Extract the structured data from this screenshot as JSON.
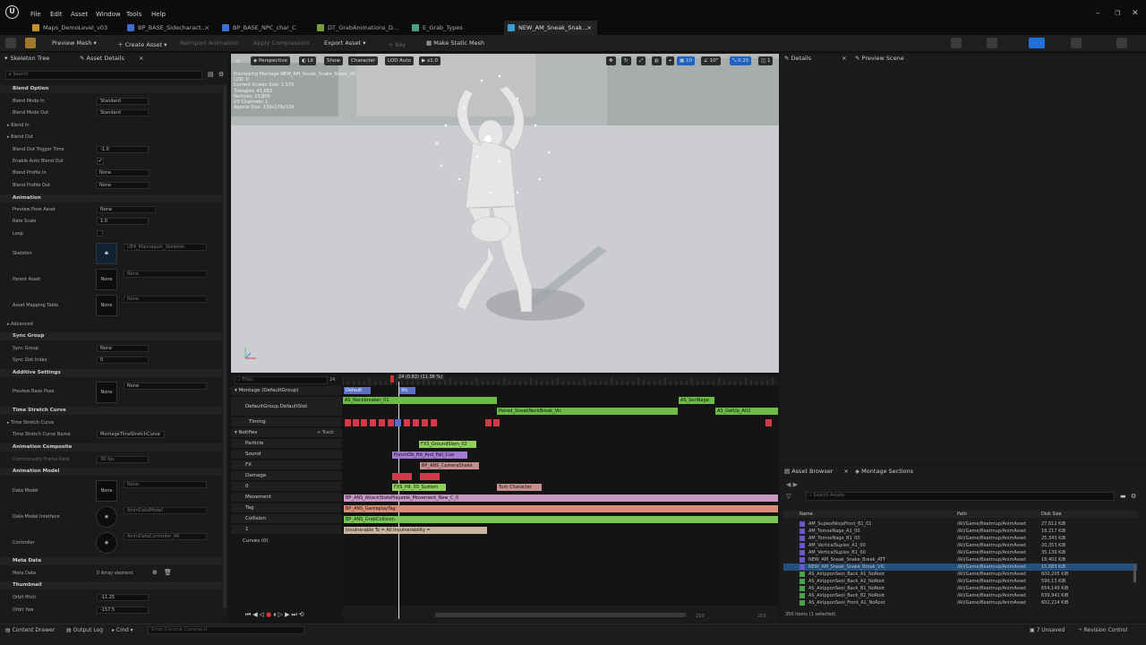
{
  "menu": [
    "File",
    "Edit",
    "Asset",
    "Window",
    "Tools",
    "Help"
  ],
  "tabs": [
    {
      "label": "Maps_DemoLevel_v03",
      "color": "#c7912d"
    },
    {
      "label": "BP_BASE_Sidecharact...",
      "color": "#3f6ed0"
    },
    {
      "label": "BP_BASE_NPC_char_C",
      "color": "#3f6ed0"
    },
    {
      "label": "DT_GrabAnimations_D...",
      "color": "#7a9b3c"
    },
    {
      "label": "E_Grab_Types",
      "color": "#4a9e8a"
    },
    {
      "label": "NEW_AM_Sneak_Snak...",
      "color": "#3aa0d4"
    }
  ],
  "toolbar": {
    "preview_mesh": "Preview Mesh",
    "create_asset": "Create Asset",
    "reimport": "Reimport Animation",
    "apply_compression": "Apply Compression",
    "export_asset": "Export Asset",
    "key": "Key",
    "make_static_mesh": "Make Static Mesh"
  },
  "left": {
    "tab1": "Skeleton Tree",
    "tab2": "Asset Details",
    "search_placeholder": "Search",
    "sections": {
      "blend_option": "Blend Option",
      "animation": "Animation",
      "sync_group": "Sync Group",
      "additive": "Additive Settings",
      "time_stretch": "Time Stretch Curve",
      "composite": "Animation Composite",
      "anim_model": "Animation Model",
      "meta_data": "Meta Data",
      "thumbnail": "Thumbnail"
    },
    "rows": {
      "blend_mode_in": "Blend Mode In",
      "blend_mode_in_val": "Standard",
      "blend_mode_out": "Blend Mode Out",
      "blend_mode_out_val": "Standard",
      "blend_in": "Blend In",
      "blend_out": "Blend Out",
      "blend_out_trigger": "Blend Out Trigger Time",
      "blend_out_trigger_val": "-1.0",
      "enable_auto_blend": "Enable Auto Blend Out",
      "blend_profile_in": "Blend Profile In",
      "blend_profile_in_val": "None",
      "blend_profile_out": "Blend Profile Out",
      "blend_profile_out_val": "None",
      "preview_pose": "Preview Pose Asset",
      "preview_pose_val": "None",
      "rate_scale": "Rate Scale",
      "rate_scale_val": "1.0",
      "loop": "Loop",
      "skeleton": "Skeleton",
      "skeleton_val": "UE4_Mannequin_Skeleton",
      "parent_asset": "Parent Asset",
      "parent_asset_val": "None",
      "asset_mapping": "Asset Mapping Table",
      "asset_mapping_val": "None",
      "advanced": "Advanced",
      "sync_group": "Sync Group",
      "sync_group_val": "None",
      "sync_slot": "Sync Slot Index",
      "sync_slot_val": "0",
      "preview_base_pose": "Preview Base Pose",
      "preview_base_pose_val": "None",
      "time_stretch_curve": "Time Stretch Curve",
      "time_stretch_name": "Time Stretch Curve Name",
      "time_stretch_name_val": "MontageTimeStretchCurve",
      "commonality": "Commonality Frame Rate",
      "commonality_val": "30 fps",
      "data_model": "Data Model",
      "data_model_val": "None",
      "data_model_iface": "Data Model Interface",
      "data_model_iface_val": "AnimDataModel",
      "controller": "Controller",
      "controller_val": "AnimDataController_A6",
      "meta": "Meta Data",
      "meta_val": "0 Array element",
      "orbit_pitch": "Orbit Pitch",
      "orbit_pitch_val": "-11.25",
      "orbit_yaw": "Orbit Yaw",
      "orbit_yaw_val": "-157.5",
      "none_thumb": "None"
    }
  },
  "viewport": {
    "perspective": "Perspective",
    "lit": "Lit",
    "show": "Show",
    "character": "Character",
    "lod": "LOD Auto",
    "speed": "x1.0",
    "info": "Previewing Montage NEW_AM_Sneak_Snake_Break_Vic\nLOD: 0\nCurrent Screen Size: 1.170\nTriangles: 41,092\nVertices: 23,809\nUV Channels: 1\nApprox Size: 139x178x139",
    "grid_snap": "10",
    "rot_snap": "10°",
    "scale_snap": "0.25",
    "cam_speed": "1"
  },
  "sequencer": {
    "filter_placeholder": "Filter",
    "frame": "24",
    "playhead": "24 (0.82) (11.36 %)",
    "tracks": {
      "montage": "Montage (DefaultGroup)",
      "slot": "DefaultGroup.DefaultSlot",
      "timing": "Timing",
      "notifies": "Notifies",
      "add_track": "+ Track",
      "particle": "Particle",
      "sound": "Sound",
      "fx": "FX",
      "damage": "Damage",
      "zero": "0",
      "movement": "Movement",
      "tag": "Tag",
      "collision": "Collision",
      "one": "1",
      "curves": "Curves (0)"
    },
    "sections": {
      "default": "Default",
      "vic": "Vic"
    },
    "segments": {
      "neck": "AS_Neckbreaker_01",
      "paired": "Paired_SneakNeckBreak_Vic",
      "ss": "AS_SeriNage",
      "getup": "AS_GetUp_A02"
    },
    "notifies": {
      "ground": "FXS_GroundSlam_02",
      "punch": "PunchOb_Hit_And_Fall_Cue",
      "cam": "BP_ANS_CameraShake",
      "hit": "FXS_Hit_03_System",
      "turn": "Turn Character",
      "movement": "BP_ANS_AttackStatePlayable_Movement_New_C_0",
      "tag": "BP_ANS_GameplayTag",
      "coll": "BP_ANS_GrabCollision",
      "invuln": "Invulnerable To = All Invulnerability ="
    },
    "time_end": "210",
    "time_end2": "210"
  },
  "right": {
    "details": "Details",
    "preview_scene": "Preview Scene"
  },
  "browser": {
    "tab1": "Asset Browser",
    "tab2": "Montage Sections",
    "search_placeholder": "Search Assets",
    "col_name": "Name",
    "col_path": "Path",
    "col_size": "Disk Size",
    "rows": [
      {
        "name": "AM_SuplexNinjaFront_B1_01",
        "path": "/All/Game/Beatmup/AnimAsset",
        "size": "27,612 KiB",
        "c": "#6b53c9"
      },
      {
        "name": "AM_TomoeNage_A1_00",
        "path": "/All/Game/Beatmup/AnimAsset",
        "size": "18,217 KiB",
        "c": "#6b53c9"
      },
      {
        "name": "AM_TomoeNage_B1_00",
        "path": "/All/Game/Beatmup/AnimAsset",
        "size": "25,343 KiB",
        "c": "#6b53c9"
      },
      {
        "name": "AM_VerticalSuplex_A1_00",
        "path": "/All/Game/Beatmup/AnimAsset",
        "size": "20,353 KiB",
        "c": "#6b53c9"
      },
      {
        "name": "AM_VerticalSuplex_B1_00",
        "path": "/All/Game/Beatmup/AnimAsset",
        "size": "35,139 KiB",
        "c": "#6b53c9"
      },
      {
        "name": "NEW_AM_Sneak_Snake_Break_ATT",
        "path": "/All/Game/Beatmup/AnimAsset",
        "size": "18,402 KiB",
        "c": "#6b53c9"
      },
      {
        "name": "NEW_AM_Sneak_Snake_Break_VIC",
        "path": "/All/Game/Beatmup/AnimAsset",
        "size": "15,683 KiB",
        "c": "#6b53c9"
      },
      {
        "name": "AS_AirIpponSeoi_Back_A1_NoRoot",
        "path": "/All/Game/Beatmup/AnimAsset",
        "size": "600,205 KiB",
        "c": "#4aa14a"
      },
      {
        "name": "AS_AirIpponSeoi_Back_A2_NoRoot",
        "path": "/All/Game/Beatmup/AnimAsset",
        "size": "590,13 KiB",
        "c": "#4aa14a"
      },
      {
        "name": "AS_AirIpponSeoi_Back_B1_NoRoot",
        "path": "/All/Game/Beatmup/AnimAsset",
        "size": "654,149 KiB",
        "c": "#4aa14a"
      },
      {
        "name": "AS_AirIpponSeoi_Back_B2_NoRoot",
        "path": "/All/Game/Beatmup/AnimAsset",
        "size": "639,941 KiB",
        "c": "#4aa14a"
      },
      {
        "name": "AS_AirIpponSeoi_Front_A1_NoRoot",
        "path": "/All/Game/Beatmup/AnimAsset",
        "size": "602,214 KiB",
        "c": "#4aa14a"
      }
    ],
    "count": "350 items (1 selected)"
  },
  "status": {
    "content_drawer": "Content Drawer",
    "output_log": "Output Log",
    "cmd": "Cmd",
    "console_placeholder": "Enter Console Command",
    "unsaved": "7 Unsaved",
    "revision": "Revision Control"
  }
}
